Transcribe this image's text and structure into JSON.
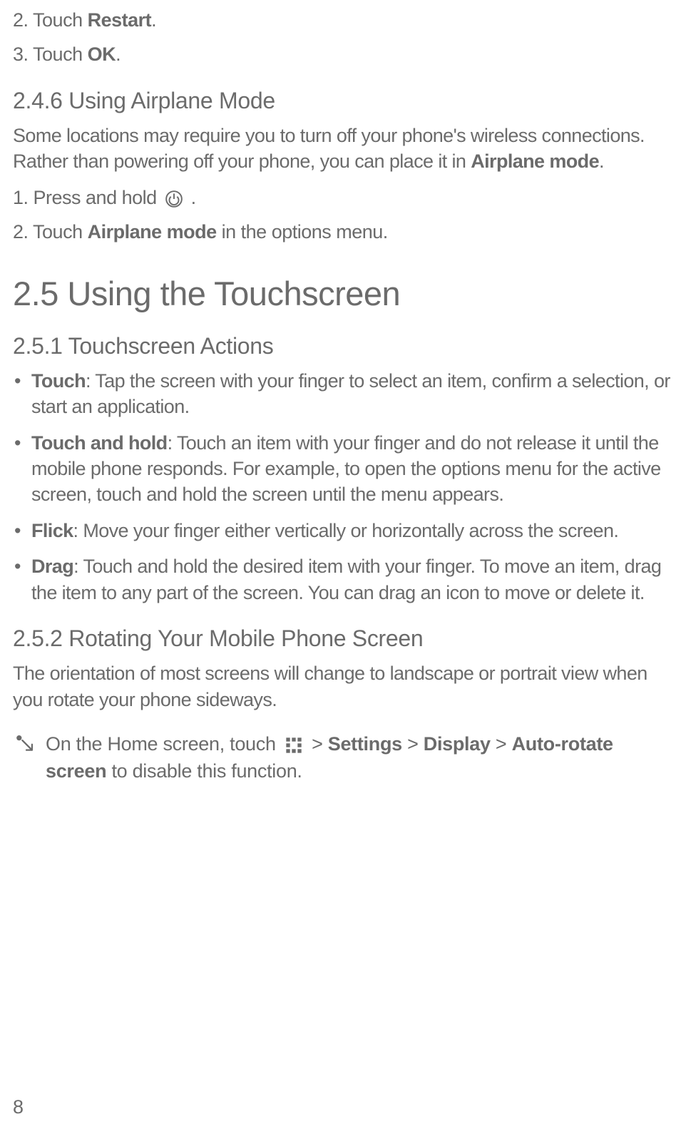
{
  "step2": {
    "prefix": "2. Touch ",
    "bold": "Restart",
    "suffix": "."
  },
  "step3": {
    "prefix": "3. Touch ",
    "bold": "OK",
    "suffix": "."
  },
  "section246": {
    "heading": "2.4.6  Using Airplane Mode",
    "para_prefix": "Some locations may require you to turn off your phone's wireless connections. Rather than powering off your phone, you can place it in ",
    "para_bold": "Airplane mode",
    "para_suffix": ".",
    "step1_prefix": "1. Press and hold ",
    "step1_suffix": " .",
    "step2_prefix": "2. Touch ",
    "step2_bold": "Airplane mode",
    "step2_suffix": " in the options menu."
  },
  "section25": {
    "heading": "2.5  Using the Touchscreen"
  },
  "section251": {
    "heading": "2.5.1  Touchscreen Actions",
    "bullets": [
      {
        "bold": "Touch",
        "text": ": Tap the screen with your finger to select an item, confirm a selection, or start an application."
      },
      {
        "bold": "Touch and hold",
        "text": ": Touch an item with your finger and do not release it until the mobile phone responds. For example, to open the options menu for the active screen, touch and hold the screen until the menu appears."
      },
      {
        "bold": "Flick",
        "text": ": Move your finger either vertically or horizontally across the screen."
      },
      {
        "bold": "Drag",
        "text": ": Touch and hold the desired item with your finger. To move an item, drag the item to any part of the screen. You can drag an icon to move or delete it."
      }
    ]
  },
  "section252": {
    "heading": "2.5.2  Rotating Your Mobile Phone Screen",
    "para": "The orientation of most screens will change to landscape or portrait view when you rotate your phone sideways.",
    "note_prefix": "On the Home screen, touch ",
    "note_gt1": " > ",
    "note_settings": "Settings",
    "note_gt2": " > ",
    "note_display": "Display",
    "note_gt3": " > ",
    "note_autorotate": "Auto-rotate screen",
    "note_suffix": " to disable this function."
  },
  "pageNumber": "8"
}
